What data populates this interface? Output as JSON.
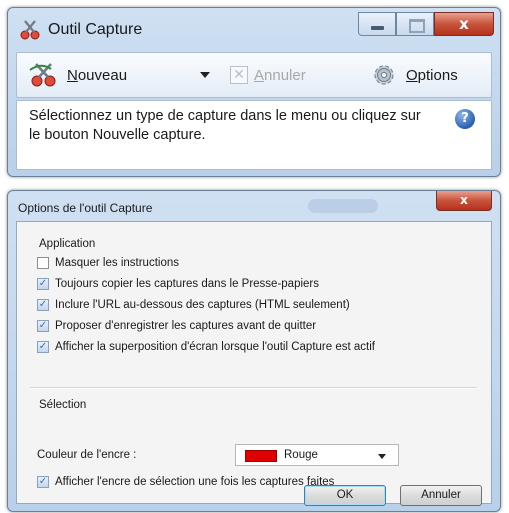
{
  "capture_window": {
    "title": "Outil Capture",
    "toolbar": {
      "new_label_first": "N",
      "new_label_rest": "ouveau",
      "cancel_label_first": "A",
      "cancel_label_rest": "nnuler",
      "options_label_first": "O",
      "options_label_rest": "ptions"
    },
    "info_text": "Sélectionnez un type de capture dans le menu ou cliquez sur le bouton Nouvelle capture.",
    "help_glyph": "?",
    "close_glyph": "x"
  },
  "options_dialog": {
    "title": "Options de l'outil Capture",
    "close_glyph": "x",
    "application_group": {
      "label": "Application",
      "options": [
        {
          "label": "Masquer les instructions",
          "checked": false
        },
        {
          "label": "Toujours copier les captures dans le Presse-papiers",
          "checked": true
        },
        {
          "label": "Inclure l'URL au-dessous des captures (HTML seulement)",
          "checked": true
        },
        {
          "label": "Proposer d'enregistrer les captures avant de quitter",
          "checked": true
        },
        {
          "label": "Afficher la superposition d'écran lorsque l'outil Capture est actif",
          "checked": true
        }
      ]
    },
    "selection_group": {
      "label": "Sélection",
      "ink_color_label": "Couleur de l'encre :",
      "ink_color_value": "Rouge",
      "ink_color_swatch": "#e00000",
      "show_ink_label": "Afficher l'encre de sélection une fois les captures faites",
      "show_ink_checked": true
    },
    "ok_label": "OK",
    "cancel_label": "Annuler"
  }
}
